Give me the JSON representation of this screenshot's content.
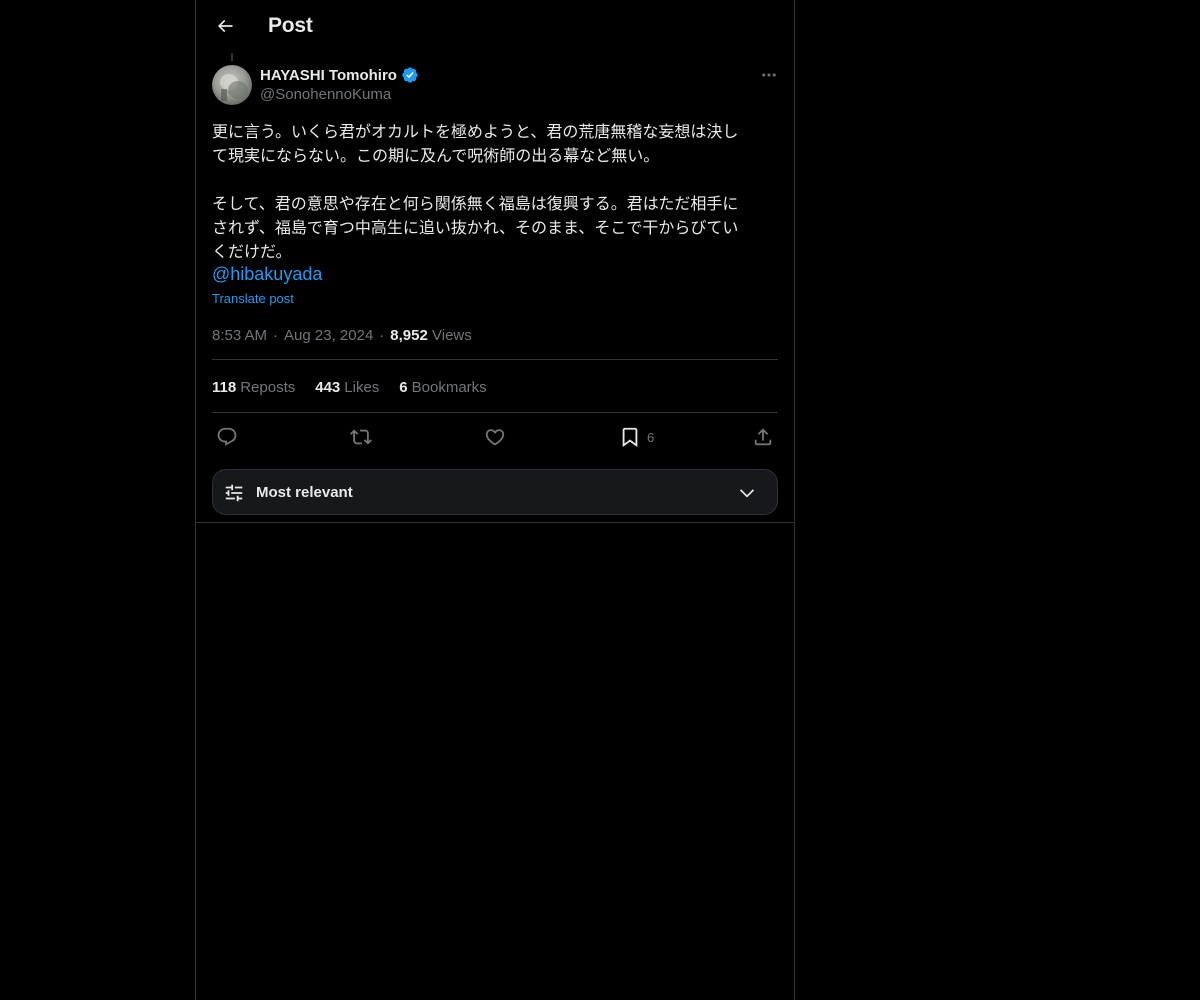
{
  "header": {
    "title": "Post"
  },
  "post": {
    "author_name": "HAYASHI Tomohiro",
    "author_handle": "@SonohennoKuma",
    "body": "更に言う。いくら君がオカルトを極めようと、君の荒唐無稽な妄想は決し\nて現実にならない。この期に及んで呪術師の出る幕など無い。\n\nそして、君の意思や存在と何ら関係無く福島は復興する。君はただ相手に\nされず、福島で育つ中高生に追い抜かれ、そのまま、そこで干からびてい\nくだけだ。",
    "mention": "@hibakuyada",
    "translate_label": "Translate post",
    "time": "8:53 AM",
    "date": "Aug 23, 2024",
    "separator": "·",
    "views_count": "8,952",
    "views_label": "Views"
  },
  "stats": {
    "reposts_count": "118",
    "reposts_label": "Reposts",
    "likes_count": "443",
    "likes_label": "Likes",
    "bookmarks_count": "6",
    "bookmarks_label": "Bookmarks"
  },
  "actions": {
    "bookmark_count": "6"
  },
  "sort": {
    "label": "Most relevant"
  },
  "colors": {
    "background": "#000000",
    "text": "#e7e9ea",
    "muted": "#71767b",
    "accent": "#1d9bf0",
    "border": "#2f3336"
  },
  "icons": [
    "back-arrow-icon",
    "verified-badge-icon",
    "more-icon",
    "reply-icon",
    "repost-icon",
    "like-icon",
    "bookmark-icon",
    "share-icon",
    "sliders-icon",
    "chevron-down-icon"
  ]
}
